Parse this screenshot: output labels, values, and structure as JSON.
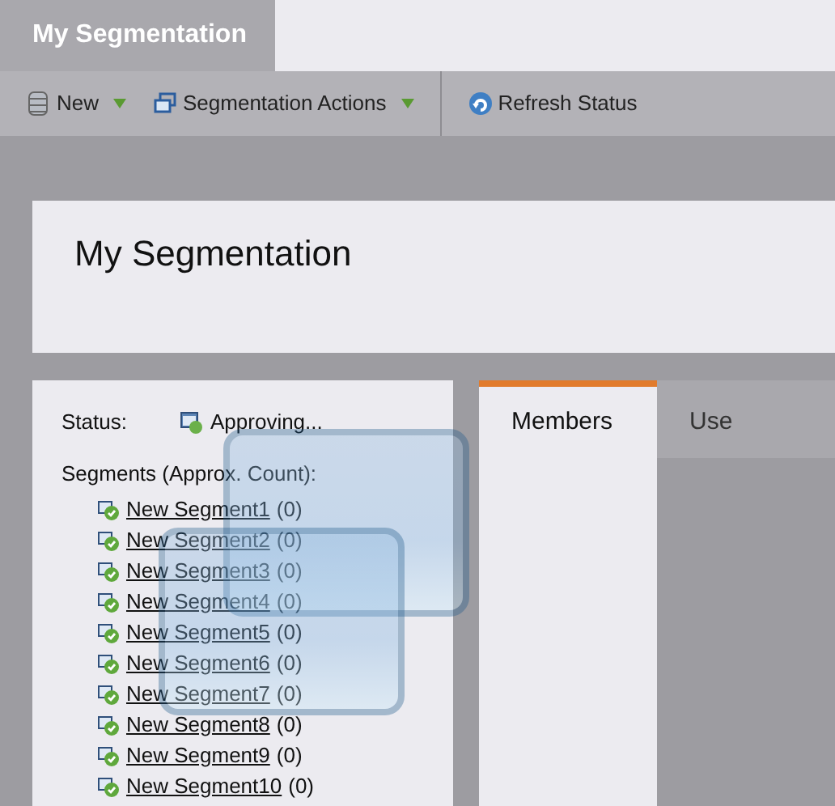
{
  "window_tabs": [
    {
      "label": "My Segmentation",
      "selected": true
    }
  ],
  "toolbar": [
    {
      "label": "New",
      "dropdown": true
    },
    {
      "label": "Segmentation Actions",
      "dropdown": true
    },
    {
      "label": "Refresh Status",
      "dropdown": false
    }
  ],
  "page_title": "My Segmentation",
  "status": {
    "label": "Status:",
    "value": "Approving..."
  },
  "segments": {
    "heading": "Segments (Approx. Count):",
    "items": [
      {
        "name": "New Segment1",
        "count": "(0)"
      },
      {
        "name": "New Segment2",
        "count": "(0)"
      },
      {
        "name": "New Segment3",
        "count": "(0)"
      },
      {
        "name": "New Segment4",
        "count": "(0)"
      },
      {
        "name": "New Segment5",
        "count": "(0)"
      },
      {
        "name": "New Segment6",
        "count": "(0)"
      },
      {
        "name": "New Segment7",
        "count": "(0)"
      },
      {
        "name": "New Segment8",
        "count": "(0)"
      },
      {
        "name": "New Segment9",
        "count": "(0)"
      },
      {
        "name": "New Segment10",
        "count": "(0)"
      }
    ]
  },
  "detail_tabs": [
    {
      "label": "Members",
      "selected": true
    },
    {
      "label": "Use",
      "selected": false
    }
  ]
}
